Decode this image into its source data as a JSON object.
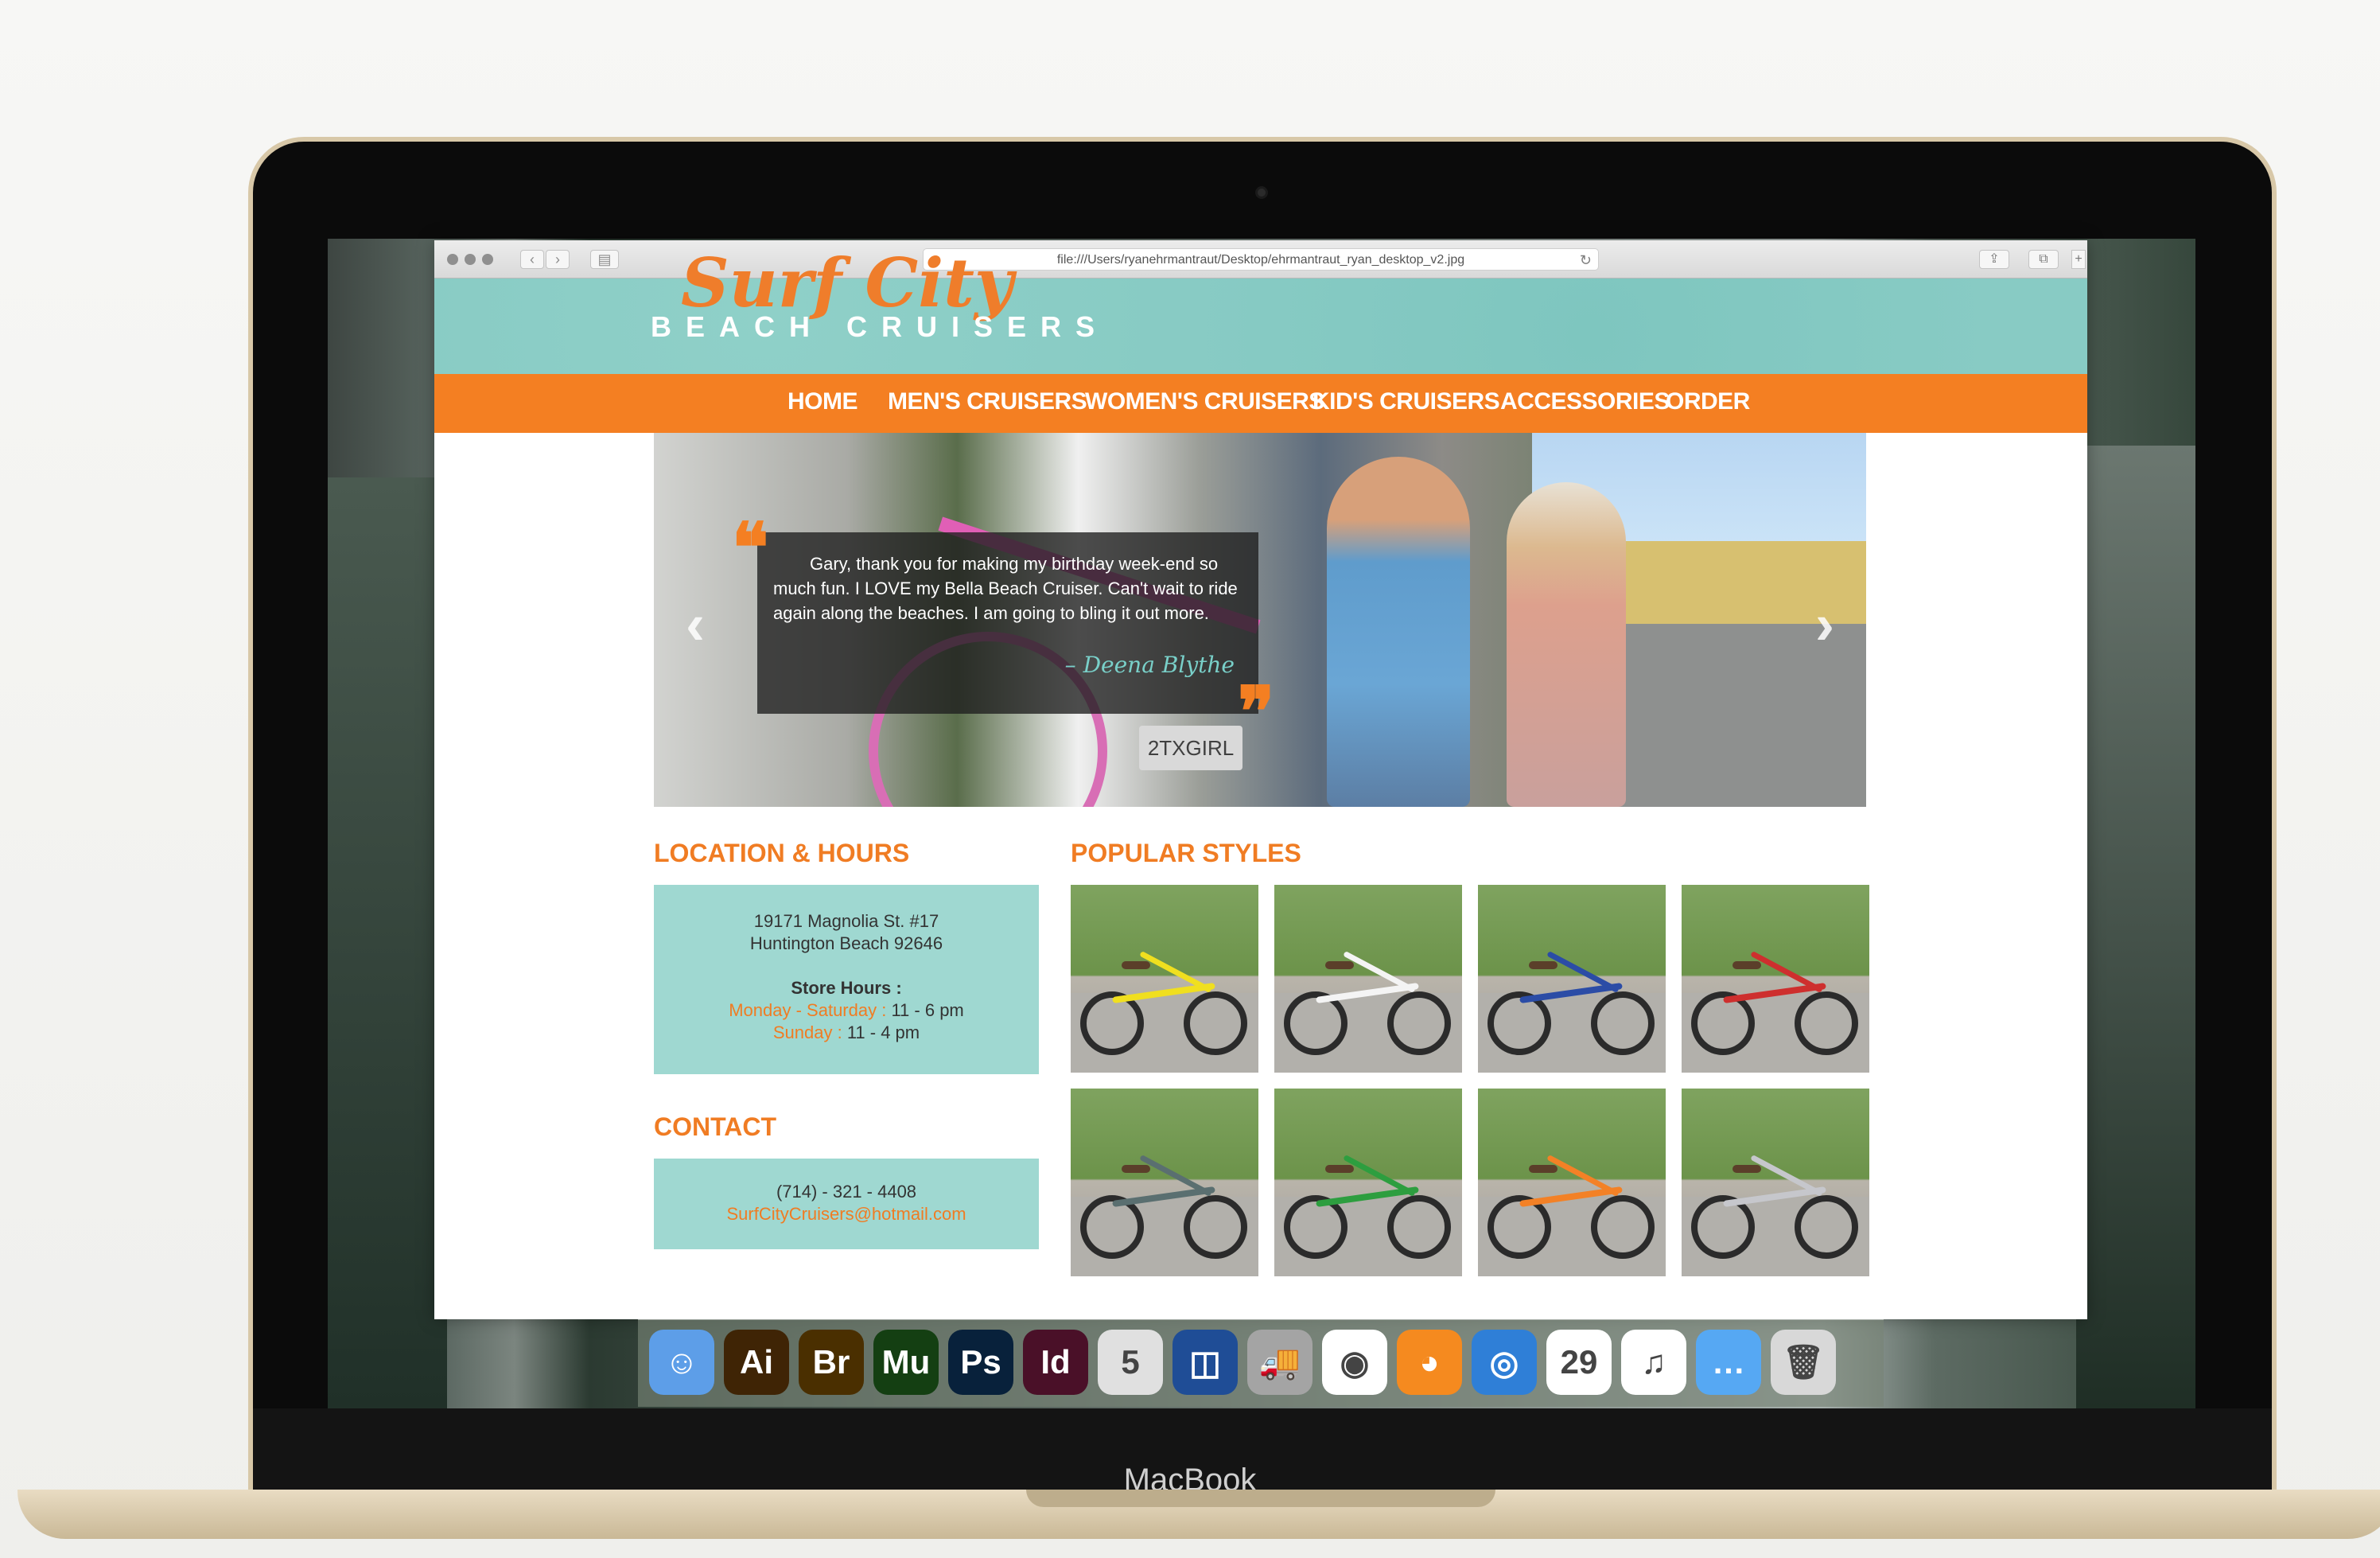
{
  "browser": {
    "url": "file:///Users/ryanehrmantraut/Desktop/ehrmantraut_ryan_desktop_v2.jpg"
  },
  "site": {
    "logo_script": "Surf City",
    "logo_main": "BEACH CRUISERS",
    "nav": [
      "HOME",
      "MEN'S CRUISERS",
      "WOMEN'S CRUISERS",
      "KID'S CRUISERS",
      "ACCESSORIES",
      "ORDER"
    ]
  },
  "hero": {
    "quote": "Gary, thank you for making my birthday week-end so much fun. I LOVE my Bella Beach Cruiser. Can't wait to ride again along the beaches. I am going to bling it out more.",
    "author": "– Deena Blythe",
    "plate": "2TXGIRL"
  },
  "location": {
    "title": "LOCATION & HOURS",
    "address_line1": "19171 Magnolia St. #17",
    "address_line2": "Huntington Beach  92646",
    "hours_title": "Store Hours :",
    "weekday_label": "Monday - Saturday :",
    "weekday_hours": " 11  -  6 pm",
    "sunday_label": "Sunday :",
    "sunday_hours": " 11  -  4 pm"
  },
  "contact": {
    "title": "CONTACT",
    "phone": "(714)  - 321 - 4408",
    "email": "SurfCityCruisers@hotmail.com"
  },
  "popular": {
    "title": "POPULAR STYLES",
    "items": [
      {
        "color": "#f0df1f"
      },
      {
        "color": "#f4f4f4"
      },
      {
        "color": "#2b4ca6"
      },
      {
        "color": "#ce2f2e"
      },
      {
        "color": "#5a6f70"
      },
      {
        "color": "#2d9e3f"
      },
      {
        "color": "#f38126"
      },
      {
        "color": "#c6c7cc"
      }
    ]
  },
  "dock": {
    "apps": [
      {
        "label": "☺",
        "color": "#5d9ee8"
      },
      {
        "label": "Ai",
        "color": "#3f2405"
      },
      {
        "label": "Br",
        "color": "#4a2f00"
      },
      {
        "label": "Mu",
        "color": "#143f12"
      },
      {
        "label": "Ps",
        "color": "#08213b"
      },
      {
        "label": "Id",
        "color": "#4a1028"
      },
      {
        "label": "5",
        "color": "#e0e0e0"
      },
      {
        "label": "◫",
        "color": "#1f4d96"
      },
      {
        "label": "🚚",
        "color": "#a4a4a4"
      },
      {
        "label": "◉",
        "color": "#ffffff"
      },
      {
        "label": "◕",
        "color": "#f58a1f"
      },
      {
        "label": "◎",
        "color": "#2f7fd7"
      },
      {
        "label": "29",
        "color": "#ffffff"
      },
      {
        "label": "♫",
        "color": "#ffffff"
      },
      {
        "label": "…",
        "color": "#56a8f3"
      },
      {
        "label": "🗑",
        "color": "#d8d8d8"
      }
    ]
  },
  "device": {
    "name": "MacBook"
  }
}
